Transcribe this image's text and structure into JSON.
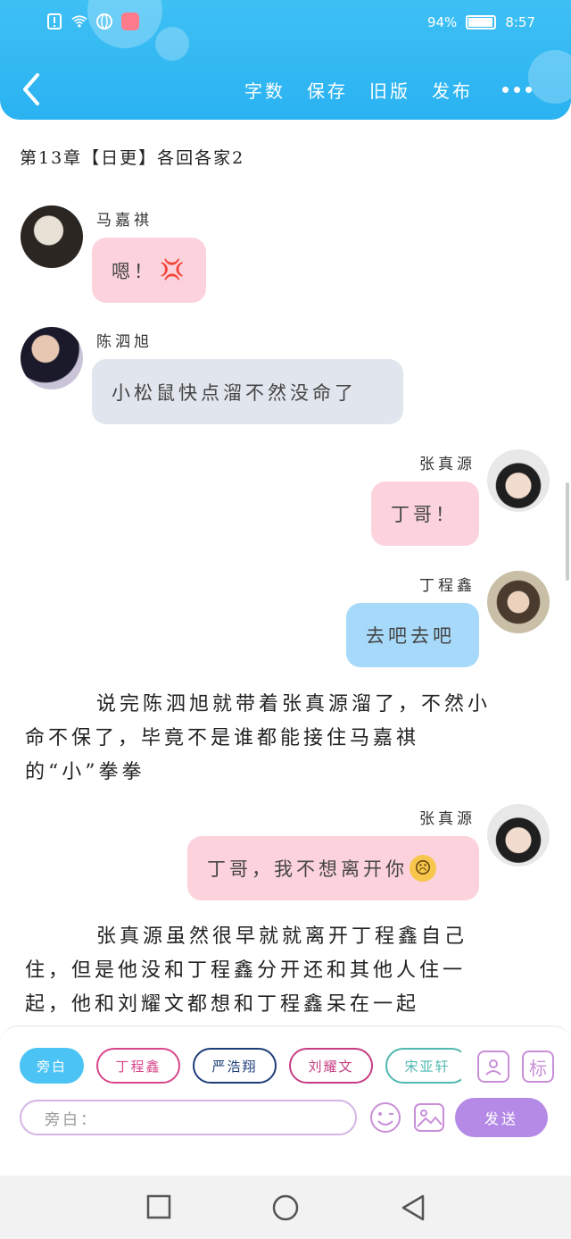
{
  "status_bar": {
    "battery": "94%",
    "time": "8:57"
  },
  "header": {
    "actions": [
      "字数",
      "保存",
      "旧版",
      "发布"
    ]
  },
  "chapter_title": "第13章【日更】各回各家2",
  "messages": [
    {
      "speaker": "马嘉祺",
      "text": "嗯！",
      "emoji": "💢"
    },
    {
      "speaker": "陈泗旭",
      "text": "小松鼠快点溜不然没命了"
    },
    {
      "speaker": "张真源",
      "text": "丁哥！"
    },
    {
      "speaker": "丁程鑫",
      "text": "去吧去吧"
    },
    {
      "speaker": "张真源",
      "text": "丁哥，我不想离开你",
      "emoji": "☹"
    }
  ],
  "narrations": [
    "说完陈泗旭就带着张真源溜了，不然小命不保了，毕竟不是谁都能接住马嘉祺的“小”拳拳",
    "张真源虽然很早就就离开丁程鑫自己住，但是他没和丁程鑫分开还和其他人住一起，他和刘耀文都想和丁程鑫呆在一起"
  ],
  "characters": [
    {
      "name": "旁白",
      "color": "#4bc3f4"
    },
    {
      "name": "丁程鑫",
      "color": "#d8468a"
    },
    {
      "name": "严浩翔",
      "color": "#1d3d78"
    },
    {
      "name": "刘耀文",
      "color": "#c63c82"
    },
    {
      "name": "宋亚轩",
      "color": "#4fb8b0"
    }
  ],
  "tools": {
    "tag_label": "标"
  },
  "input": {
    "placeholder": "旁白："
  },
  "send_label": "发送"
}
